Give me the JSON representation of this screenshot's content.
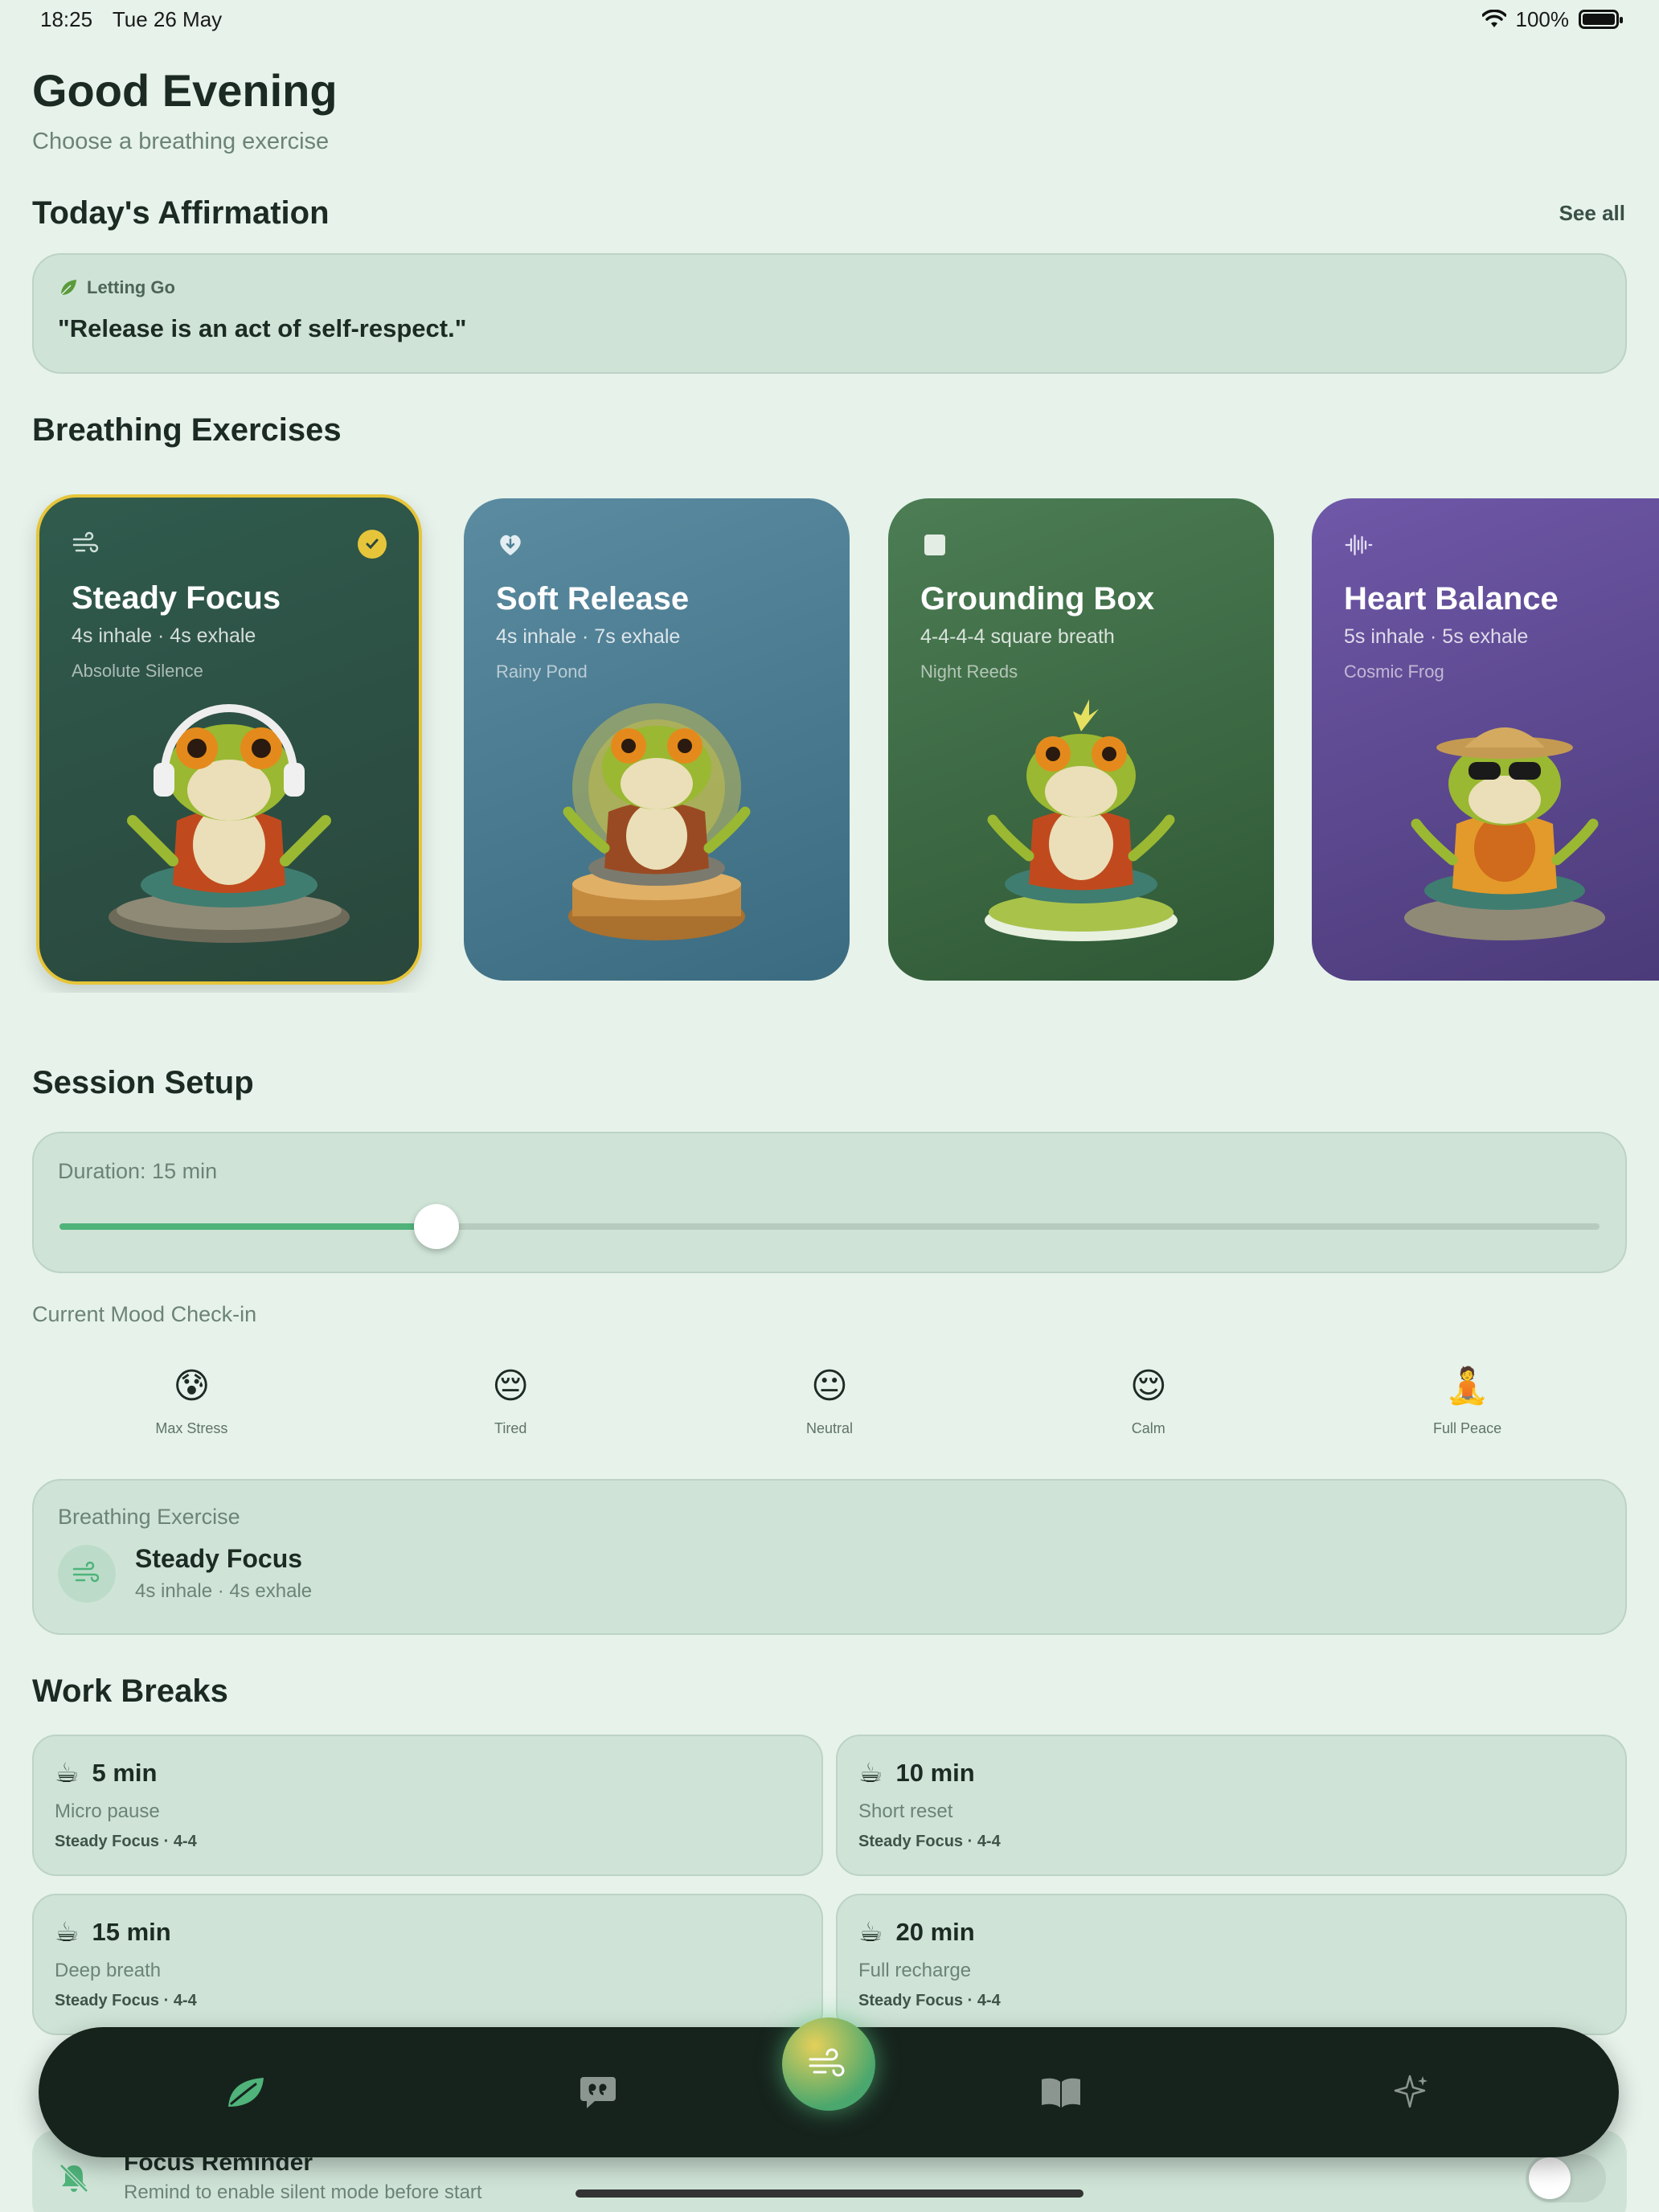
{
  "status": {
    "time": "18:25",
    "date": "Tue 26 May",
    "battery": "100%"
  },
  "header": {
    "title": "Good Evening",
    "subtitle": "Choose a breathing exercise"
  },
  "affirmation": {
    "section_title": "Today's Affirmation",
    "see_all": "See all",
    "tag": "Letting Go",
    "text": "\"Release is an act of self-respect.\""
  },
  "exercises": {
    "section_title": "Breathing Exercises",
    "cards": [
      {
        "title": "Steady Focus",
        "pattern": "4s inhale · 4s exhale",
        "sound": "Absolute Silence",
        "icon": "wind-icon",
        "selected": true,
        "color": "#2f5b4d"
      },
      {
        "title": "Soft Release",
        "pattern": "4s inhale · 7s exhale",
        "sound": "Rainy Pond",
        "icon": "heart-down-icon",
        "selected": false,
        "color": "#4f8196"
      },
      {
        "title": "Grounding Box",
        "pattern": "4-4-4-4 square breath",
        "sound": "Night Reeds",
        "icon": "square-icon",
        "selected": false,
        "color": "#3f6e46"
      },
      {
        "title": "Heart Balance",
        "pattern": "5s inhale · 5s exhale",
        "sound": "Cosmic Frog",
        "icon": "waveform-icon",
        "selected": false,
        "color": "#5e4a92"
      }
    ]
  },
  "session": {
    "section_title": "Session Setup",
    "duration_label": "Duration: 15 min",
    "duration_fraction": 0.245,
    "mood_label": "Current Mood Check-in",
    "moods": [
      {
        "emoji": "😰",
        "label": "Max Stress"
      },
      {
        "emoji": "😔",
        "label": "Tired"
      },
      {
        "emoji": "😐",
        "label": "Neutral"
      },
      {
        "emoji": "😌",
        "label": "Calm"
      },
      {
        "emoji": "🧘",
        "label": "Full Peace"
      }
    ],
    "exercise_label": "Breathing Exercise",
    "exercise_name": "Steady Focus",
    "exercise_pattern": "4s inhale · 4s exhale"
  },
  "work_breaks": {
    "section_title": "Work Breaks",
    "items": [
      {
        "time": "5 min",
        "desc": "Micro pause",
        "meta": "Steady Focus · 4-4"
      },
      {
        "time": "10 min",
        "desc": "Short reset",
        "meta": "Steady Focus · 4-4"
      },
      {
        "time": "15 min",
        "desc": "Deep breath",
        "meta": "Steady Focus · 4-4"
      },
      {
        "time": "20 min",
        "desc": "Full recharge",
        "meta": "Steady Focus · 4-4"
      }
    ]
  },
  "reminder": {
    "title": "Focus Reminder",
    "subtitle": "Remind to enable silent mode before start",
    "enabled": false
  },
  "tab_bar": {
    "tabs": [
      "leaf-icon",
      "quote-bubble-icon",
      "wind-icon",
      "book-icon",
      "sparkle-icon"
    ],
    "active": 0
  }
}
